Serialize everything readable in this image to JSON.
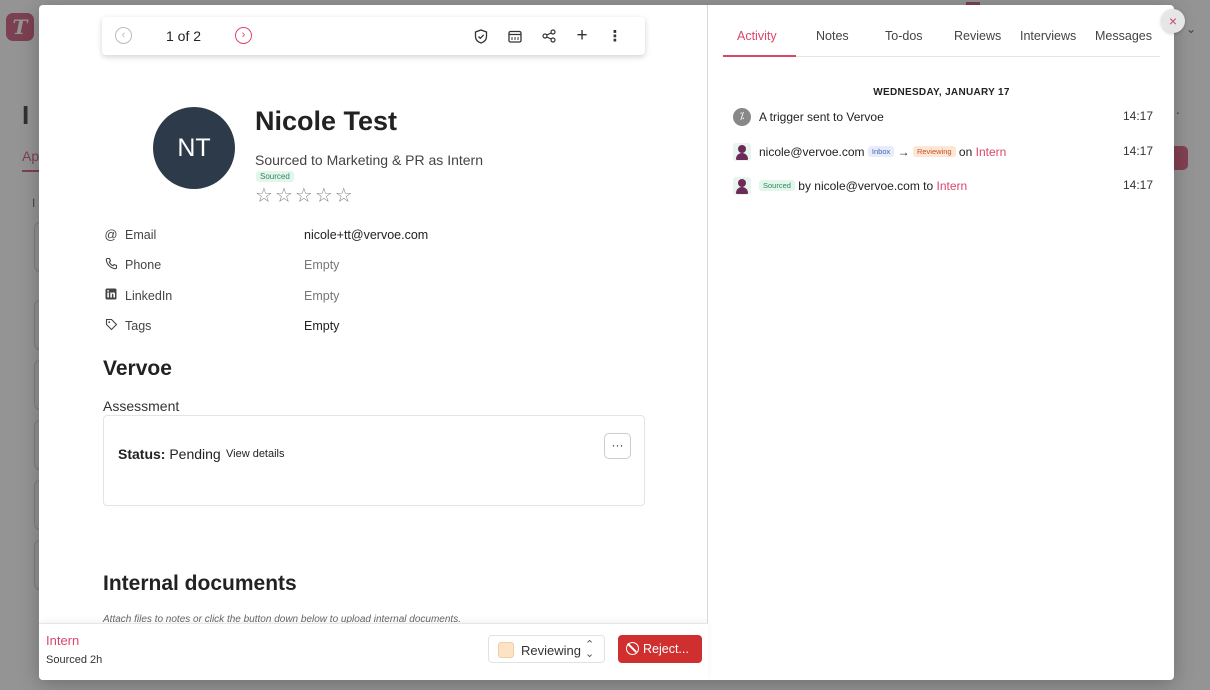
{
  "background": {
    "logo": "T",
    "title": "I",
    "tab": "Ap",
    "col": "I"
  },
  "toolbar": {
    "prev_icon": "chevron-left-icon",
    "count": "1 of 2",
    "next_icon": "chevron-right-icon",
    "icons": [
      "shield-check-icon",
      "calendar-icon",
      "share-icon",
      "plus-icon",
      "more-vertical-icon"
    ]
  },
  "candidate": {
    "initials": "NT",
    "name": "Nicole Test",
    "subtitle": "Sourced to Marketing & PR as Intern",
    "badge": "Sourced",
    "rating": 0,
    "max_rating": 5
  },
  "fields": [
    {
      "icon": "at-icon",
      "label": "Email",
      "value": "nicole+tt@vervoe.com"
    },
    {
      "icon": "phone-icon",
      "label": "Phone",
      "value": "Empty"
    },
    {
      "icon": "linkedin-icon",
      "label": "LinkedIn",
      "value": "Empty"
    },
    {
      "icon": "tag-icon",
      "label": "Tags",
      "value": "Empty"
    }
  ],
  "vervoe": {
    "heading": "Vervoe",
    "assessment_label": "Assessment",
    "status_label": "Status:",
    "status_value": "Pending",
    "view_details": "View details",
    "more": "···"
  },
  "internal_docs": {
    "heading": "Internal documents",
    "hint": "Attach files to notes or click the button down below to upload internal documents."
  },
  "footer": {
    "job": "Intern",
    "time": "Sourced 2h",
    "stage": "Reviewing",
    "stage_color": "#fbe3c4",
    "reject": "Reject..."
  },
  "close": "×",
  "tabs": [
    "Activity",
    "Notes",
    "To-dos",
    "Reviews",
    "Interviews",
    "Messages"
  ],
  "active_tab": "Activity",
  "activity": {
    "day": "WEDNESDAY, JANUARY 17",
    "items": [
      {
        "icon": "trigger-icon",
        "text": "A trigger sent to Vervoe",
        "time": "14:17"
      },
      {
        "icon": "user-avatar-icon",
        "actor": "nicole@vervoe.com",
        "from": "Inbox",
        "arrow": "→",
        "to": "Reviewing",
        "on": "on",
        "target": "Intern",
        "time": "14:17"
      },
      {
        "icon": "user-avatar-icon",
        "badge": "Sourced",
        "by": "by nicole@vervoe.com to",
        "target": "Intern",
        "time": "14:17"
      }
    ]
  },
  "colors": {
    "accent": "#d9476d",
    "reject": "#cf2f2f",
    "avatar": "#2c3a4a"
  }
}
